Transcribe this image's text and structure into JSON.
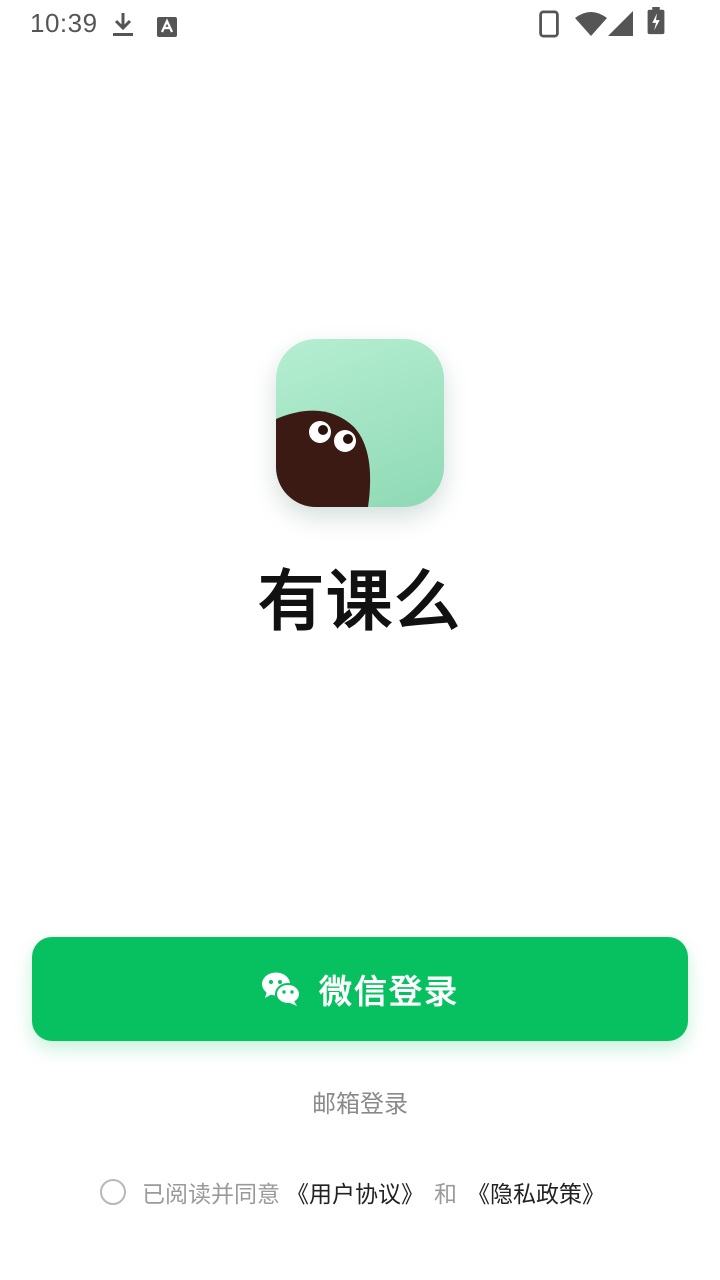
{
  "status_bar": {
    "time": "10:39",
    "icons": [
      "download-icon",
      "keyboard-a-icon",
      "phone-icon",
      "wifi-icon",
      "signal-icon",
      "battery-charging-icon"
    ]
  },
  "app": {
    "name": "有课么"
  },
  "colors": {
    "wechat_green": "#07c160",
    "logo_gradient_top": "#b6eed2",
    "logo_gradient_bottom": "#8ed9b6",
    "logo_creature": "#3a1a12"
  },
  "login": {
    "wechat_label": "微信登录",
    "email_label": "邮箱登录"
  },
  "agreement": {
    "prefix": "已阅读并同意",
    "user_agreement": "《用户协议》",
    "and": "和",
    "privacy_policy": "《隐私政策》"
  }
}
